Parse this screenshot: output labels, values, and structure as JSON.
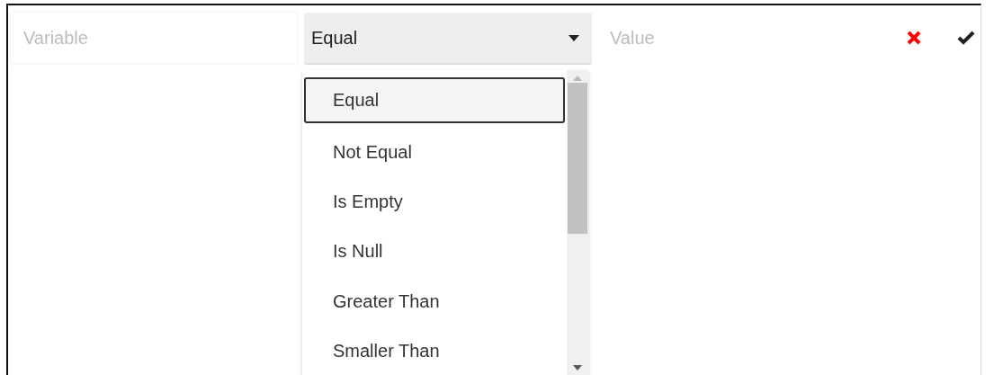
{
  "variable_field": {
    "placeholder": "Variable"
  },
  "operator_select": {
    "value": "Equal",
    "expanded": true
  },
  "value_field": {
    "placeholder": "Value"
  },
  "operator_options": [
    {
      "label": "Equal",
      "selected": true
    },
    {
      "label": "Not Equal",
      "selected": false
    },
    {
      "label": "Is Empty",
      "selected": false
    },
    {
      "label": "Is Null",
      "selected": false
    },
    {
      "label": "Greater Than",
      "selected": false
    },
    {
      "label": "Smaller Than",
      "selected": false
    }
  ]
}
